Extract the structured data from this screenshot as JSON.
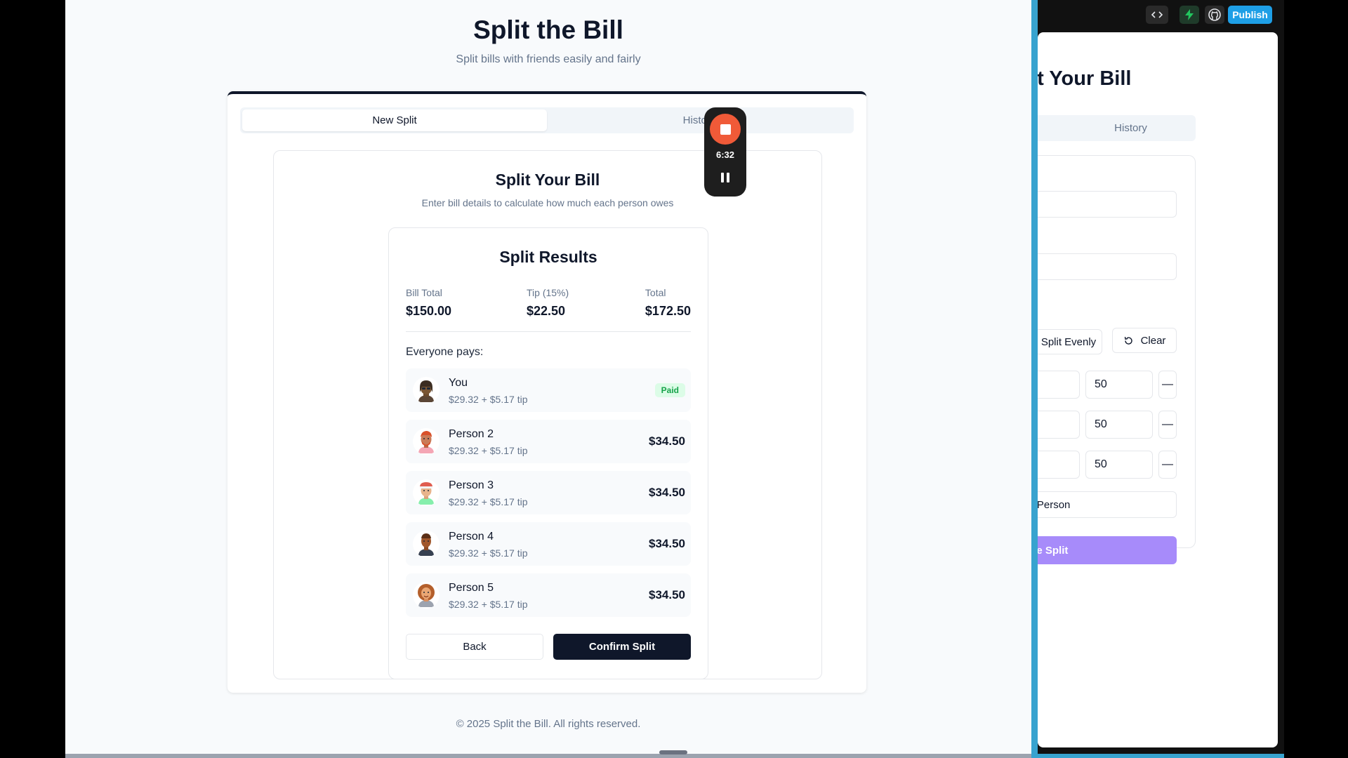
{
  "page": {
    "title": "Split the Bill",
    "subtitle": "Split bills with friends easily and fairly",
    "footer": "© 2025 Split the Bill. All rights reserved."
  },
  "tabs": [
    {
      "label": "New Split",
      "active": true
    },
    {
      "label": "History",
      "active": false
    }
  ],
  "card": {
    "title": "Split Your Bill",
    "subtitle": "Enter bill details to calculate how much each person owes"
  },
  "results": {
    "title": "Split Results",
    "summary": [
      {
        "label": "Bill Total",
        "value": "$150.00"
      },
      {
        "label": "Tip (15%)",
        "value": "$22.50"
      },
      {
        "label": "Total",
        "value": "$172.50"
      }
    ],
    "everyone_label": "Everyone pays:",
    "people": [
      {
        "name": "You",
        "detail": "$29.32 + $5.17 tip",
        "badge": "Paid",
        "avatar": "avatar-you-icon"
      },
      {
        "name": "Person 2",
        "detail": "$29.32 + $5.17 tip",
        "amount": "$34.50",
        "avatar": "avatar-person-2-icon"
      },
      {
        "name": "Person 3",
        "detail": "$29.32 + $5.17 tip",
        "amount": "$34.50",
        "avatar": "avatar-person-3-icon"
      },
      {
        "name": "Person 4",
        "detail": "$29.32 + $5.17 tip",
        "amount": "$34.50",
        "avatar": "avatar-person-4-icon"
      },
      {
        "name": "Person 5",
        "detail": "$29.32 + $5.17 tip",
        "amount": "$34.50",
        "avatar": "avatar-person-5-icon"
      }
    ],
    "back_label": "Back",
    "confirm_label": "Confirm Split"
  },
  "recorder": {
    "time": "6:32"
  },
  "toolbar": {
    "publish_label": "Publish"
  },
  "preview": {
    "title": "Split Your Bill",
    "history_tab": "History",
    "split_evenly_label": "Split Evenly",
    "clear_label": "Clear",
    "shares": [
      "50",
      "50",
      "50"
    ],
    "minus_label": "—",
    "add_person_label": "Add Person",
    "calculate_label": "Calculate Split"
  },
  "colors": {
    "primary": "#0f172a",
    "recorder_stop": "#f05a38",
    "paid_green": "#16a34a",
    "publish_blue": "#1e9fe6",
    "calculate_purple": "#a78bfa"
  }
}
